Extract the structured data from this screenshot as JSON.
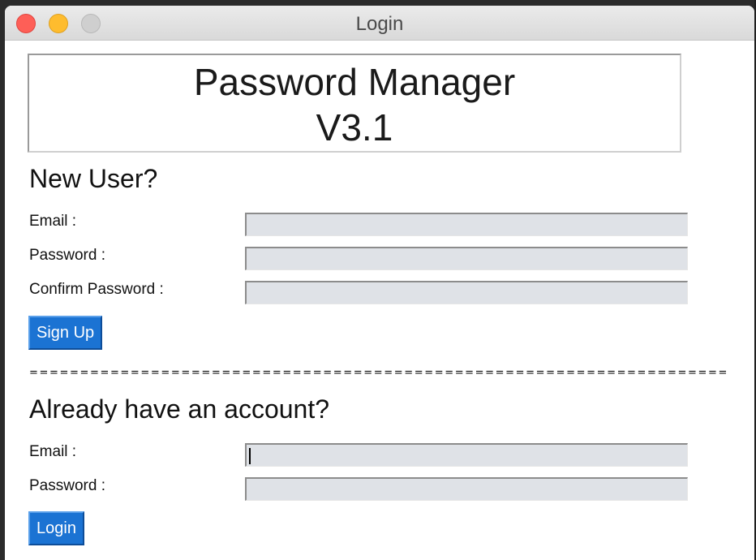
{
  "window": {
    "title": "Login"
  },
  "header": {
    "line1": "Password Manager",
    "line2": "V3.1"
  },
  "signup": {
    "heading": "New User?",
    "email_label": "Email :",
    "password_label": "Password :",
    "confirm_label": "Confirm Password :",
    "email_value": "",
    "password_value": "",
    "confirm_value": "",
    "button_label": "Sign Up"
  },
  "divider": "==========================================================================",
  "login": {
    "heading": "Already have an account?",
    "email_label": "Email :",
    "password_label": "Password :",
    "email_value": "",
    "password_value": "",
    "button_label": "Login"
  },
  "colors": {
    "button": "#1b73d3",
    "input_bg": "#dfe2e7",
    "close": "#fe5f57",
    "minimize": "#febc2e"
  }
}
